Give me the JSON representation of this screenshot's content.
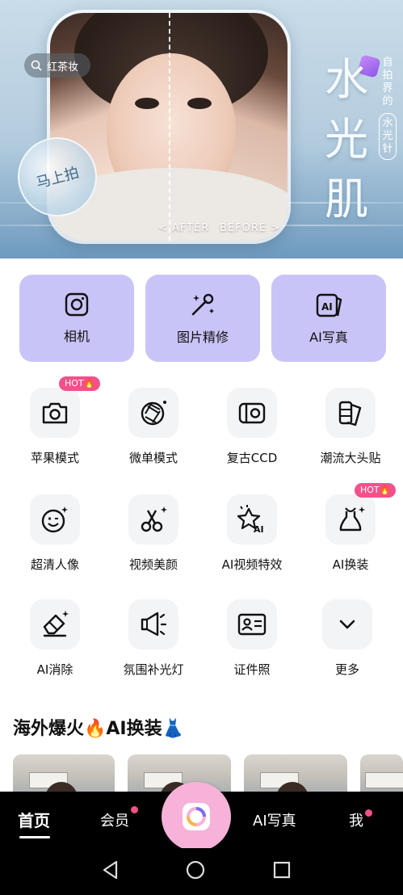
{
  "banner": {
    "search_text": "红茶妆",
    "shoot_badge": "马上拍",
    "after_label": "< AFTER",
    "before_label": "BEFORE >",
    "big_title": "水光肌",
    "side_tag_top": "自拍界的",
    "side_tag_pill": "水光针"
  },
  "features": [
    {
      "label": "相机",
      "icon": "camera-icon"
    },
    {
      "label": "图片精修",
      "icon": "magic-wand-icon"
    },
    {
      "label": "AI写真",
      "icon": "ai-photo-icon"
    }
  ],
  "tools": [
    {
      "label": "苹果模式",
      "icon": "camera-icon",
      "badge": "HOT🔥"
    },
    {
      "label": "微单模式",
      "icon": "aperture-icon"
    },
    {
      "label": "复古CCD",
      "icon": "ccd-camera-icon"
    },
    {
      "label": "潮流大头贴",
      "icon": "photo-strip-icon"
    },
    {
      "label": "超清人像",
      "icon": "smile-sparkle-icon"
    },
    {
      "label": "视频美颜",
      "icon": "scissors-icon"
    },
    {
      "label": "AI视频特效",
      "icon": "ai-effects-icon"
    },
    {
      "label": "AI换装",
      "icon": "dress-icon",
      "badge": "HOT🔥"
    },
    {
      "label": "AI消除",
      "icon": "eraser-icon"
    },
    {
      "label": "氛围补光灯",
      "icon": "megaphone-light-icon"
    },
    {
      "label": "证件照",
      "icon": "id-card-icon"
    },
    {
      "label": "更多",
      "icon": "chevron-down-icon"
    }
  ],
  "section": {
    "title": "海外爆火🔥AI换装👗"
  },
  "nav": {
    "home": "首页",
    "vip": "会员",
    "ai": "AI写真",
    "me": "我"
  },
  "colors": {
    "card": "#c9c4f7",
    "accent_pink": "#f4508b",
    "nav_bg": "#000000"
  }
}
